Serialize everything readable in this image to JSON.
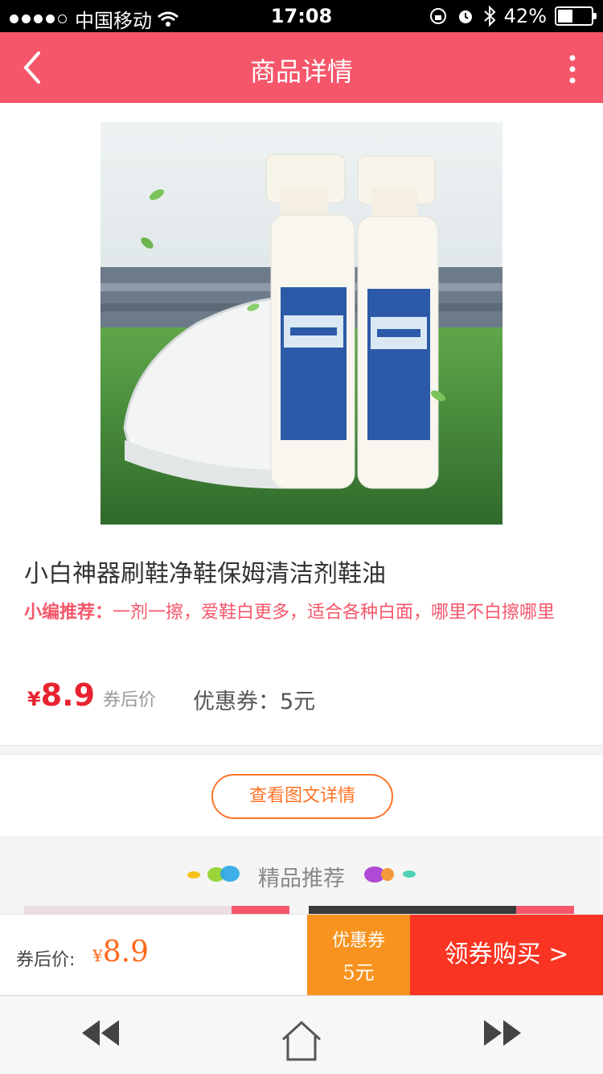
{
  "status": {
    "carrier": "中国移动",
    "time": "17:08",
    "battery": "42%"
  },
  "nav": {
    "title": "商品详情"
  },
  "product": {
    "name": "小白神器刷鞋净鞋保姆清洁剂鞋油",
    "reco_label": "小编推荐：",
    "reco_text": "一剂一擦，爱鞋白更多，适合各种白面，哪里不白擦哪里",
    "currency": "¥",
    "price": "8.9",
    "price_label": "券后价",
    "coupon_text": "优惠券：5元"
  },
  "detail_button": "查看图文详情",
  "recommend_title": "精品推荐",
  "buybar": {
    "label": "券后价:",
    "currency": "¥",
    "price": "8.9",
    "coupon_line1": "优惠券",
    "coupon_line2": "5元",
    "buy": "领券购买 >"
  },
  "colors": {
    "nav": "#f5566a",
    "price": "#e8232f",
    "coupon": "#f7931e",
    "buy": "#fa3422"
  },
  "icons": [
    "back-icon",
    "more-icon",
    "wifi-icon",
    "alarm-icon",
    "bluetooth-icon",
    "battery-icon",
    "rewind-icon",
    "home-icon",
    "forward-icon"
  ]
}
